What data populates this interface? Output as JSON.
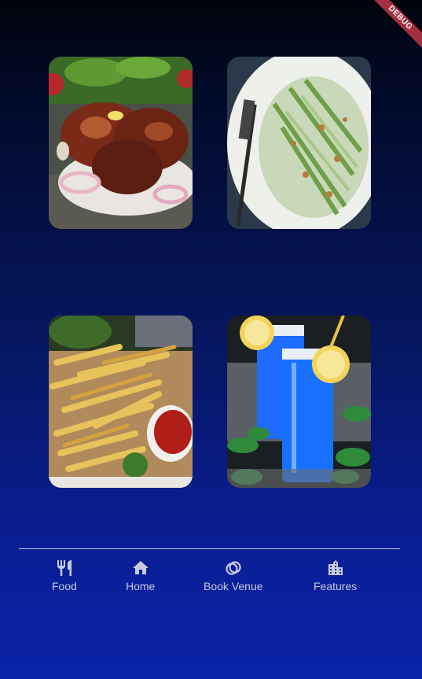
{
  "debug_banner": "DEBUG",
  "tiles": [
    {
      "icon": "tandoori-chicken-photo"
    },
    {
      "icon": "green-salad-photo"
    },
    {
      "icon": "french-fries-photo"
    },
    {
      "icon": "blue-lemonade-photo"
    }
  ],
  "nav": {
    "items": [
      {
        "label": "Food",
        "icon": "fork-knife-icon"
      },
      {
        "label": "Home",
        "icon": "home-icon"
      },
      {
        "label": "Book Venue",
        "icon": "rings-icon"
      },
      {
        "label": "Features",
        "icon": "building-icon"
      }
    ]
  },
  "colors": {
    "background_top": "#01040c",
    "background_bottom": "#0a22a8",
    "nav_text": "#c6cbdc",
    "debug_ribbon": "#a23040"
  }
}
